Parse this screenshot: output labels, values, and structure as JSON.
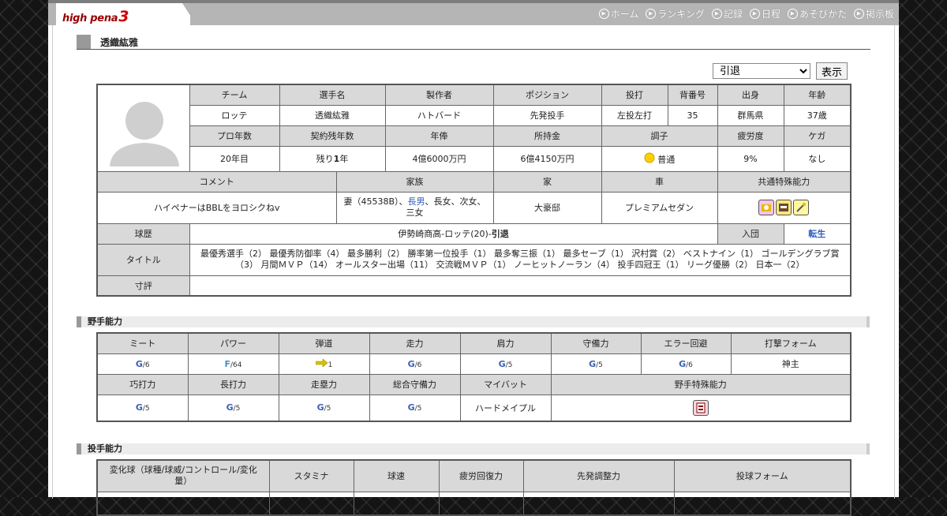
{
  "header": {
    "logo_text": "high pena",
    "logo_num": "3",
    "nav": [
      {
        "icon": "play-circle-icon",
        "label": "ホーム"
      },
      {
        "icon": "play-circle-icon",
        "label": "ランキング"
      },
      {
        "icon": "play-circle-icon",
        "label": "記録"
      },
      {
        "icon": "play-circle-icon",
        "label": "日程"
      },
      {
        "icon": "play-circle-icon",
        "label": "あそびかた"
      },
      {
        "icon": "play-circle-icon",
        "label": "掲示板"
      }
    ]
  },
  "player": {
    "name": "透織紘雅"
  },
  "controls": {
    "select_value": "引退",
    "show_label": "表示"
  },
  "profile": {
    "headers1": [
      "チーム",
      "選手名",
      "製作者",
      "ポジション",
      "投打",
      "背番号",
      "出身",
      "年齢"
    ],
    "values1": [
      "ロッテ",
      "透織紘雅",
      "ハトバード",
      "先発投手",
      "左投左打",
      "35",
      "群馬県",
      "37歳"
    ],
    "headers2": [
      "プロ年数",
      "契約残年数",
      "年俸",
      "所持金",
      "調子",
      "疲労度",
      "ケガ"
    ],
    "values2": {
      "pro_years": "20年目",
      "contract_prefix": "残り",
      "contract_num": "1",
      "contract_suffix": "年",
      "salary": "4億6000万円",
      "money": "6億4150万円",
      "condition": "普通",
      "fatigue": "9%",
      "injury": "なし"
    },
    "headers3": [
      "コメント",
      "家族",
      "家",
      "車",
      "共通特殊能力"
    ],
    "comment": "ハイペナーはBBLをヨロシクねv",
    "family_a": "妻（45538B）、",
    "family_link": "長男",
    "family_b": "、長女、次女、",
    "family_c": "三女",
    "house": "大豪邸",
    "car": "プレミアムセダン",
    "career_label": "球歴",
    "career_text": "伊勢崎商高-ロッテ(20)-",
    "career_bold": "引退",
    "join_label": "入団",
    "join_value": "転生",
    "title_label": "タイトル",
    "title_text": "最優秀選手（2） 最優秀防御率（4） 最多勝利（2） 勝率第一位投手（1） 最多奪三振（1） 最多セーブ（1） 沢村賞（2） ベストナイン（1） ゴールデングラブ賞（3） 月間ＭＶＰ（14） オールスター出場（11） 交流戦ＭＶＰ（1） ノーヒットノーラン（4） 投手四冠王（1） リーグ優勝（2） 日本一（2）",
    "review_label": "寸評",
    "review_text": ""
  },
  "fielder": {
    "section_title": "野手能力",
    "headers1": [
      "ミート",
      "パワー",
      "弾道",
      "走力",
      "肩力",
      "守備力",
      "エラー回避",
      "打撃フォーム"
    ],
    "meet": {
      "rank": "G",
      "val": "/6"
    },
    "power": {
      "rank": "F",
      "val": "/64"
    },
    "trajectory": "1",
    "speed": {
      "rank": "G",
      "val": "/6"
    },
    "arm": {
      "rank": "G",
      "val": "/5"
    },
    "defense": {
      "rank": "G",
      "val": "/5"
    },
    "error": {
      "rank": "G",
      "val": "/6"
    },
    "batting_form": "神主",
    "headers2": [
      "巧打力",
      "長打力",
      "走塁力",
      "総合守備力",
      "マイバット",
      "野手特殊能力"
    ],
    "contact": {
      "rank": "G",
      "val": "/5"
    },
    "long_hit": {
      "rank": "G",
      "val": "/5"
    },
    "baserun": {
      "rank": "G",
      "val": "/5"
    },
    "total_def": {
      "rank": "G",
      "val": "/5"
    },
    "my_bat": "ハードメイプル"
  },
  "pitcher": {
    "section_title": "投手能力",
    "header_a": "変化球（球種/球威/コントロール/変化",
    "header_b": "量）",
    "headers": [
      "スタミナ",
      "球速",
      "疲労回復力",
      "先発調整力",
      "投球フォーム"
    ]
  },
  "colors": {
    "rank_blue": "#3b5fb5",
    "rank_f": "#4a90c8",
    "header_bg": "#d9d9d9"
  }
}
